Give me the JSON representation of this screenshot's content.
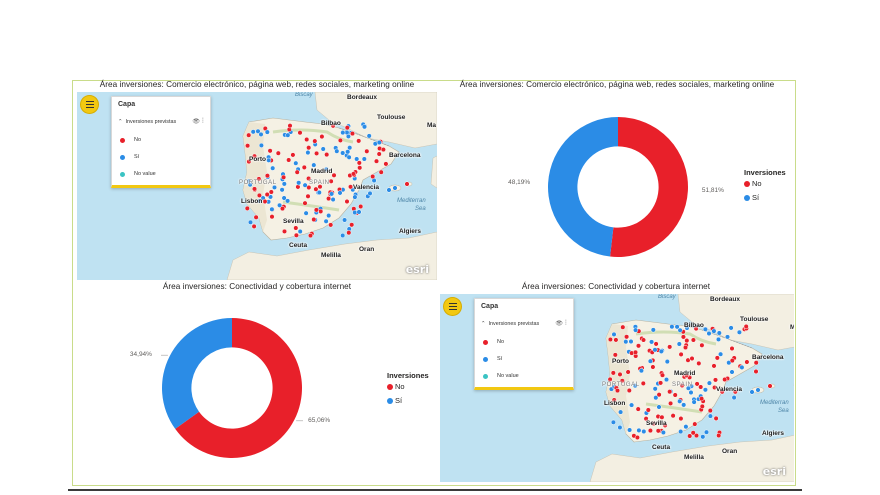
{
  "colors": {
    "no": "#e8202a",
    "si": "#2b8ce6",
    "no_value": "#3ac3c3",
    "accent": "#f2c811"
  },
  "visuals": {
    "map1": {
      "title": "Área inversiones: Comercio electrónico, página web, redes sociales, marketing online"
    },
    "donut1": {
      "title": "Área inversiones: Comercio electrónico, página web, redes sociales, marketing online"
    },
    "donut2": {
      "title": "Área inversiones: Conectividad y cobertura internet"
    },
    "map2": {
      "title": "Área inversiones: Conectividad y cobertura internet"
    }
  },
  "map_legend": {
    "title": "Capa",
    "layer_label": "Inversiones previstas",
    "eye_icon": "eye-icon",
    "more_icon": "more-options-icon",
    "items": [
      {
        "label": "No",
        "color": "#e8202a"
      },
      {
        "label": "Sí",
        "color": "#2b8ce6"
      },
      {
        "label": "No value",
        "color": "#3ac3c3"
      }
    ]
  },
  "map_labels": {
    "biscay": "Biscay",
    "bordeaux": "Bordeaux",
    "toulouse": "Toulouse",
    "ma": "Ma",
    "bilbao": "Bilbao",
    "porto": "Porto",
    "barcelona": "Barcelona",
    "madrid": "Madrid",
    "portugal": "PORTUGAL",
    "spain": "SPAIN",
    "valencia": "Valencia",
    "lisbon": "Lisbon",
    "mediterranean": "Mediterran",
    "sea": "Sea",
    "sevilla": "Sevilla",
    "ceuta": "Ceuta",
    "oran": "Oran",
    "melilla": "Melilla",
    "algiers": "Algiers",
    "esri": "esri"
  },
  "donut_legend": {
    "title": "Inversiones",
    "no": "No",
    "si": "Sí"
  },
  "chart_data": [
    {
      "type": "pie",
      "title": "Área inversiones: Comercio electrónico, página web, redes sociales, marketing online",
      "categories": [
        "No",
        "Sí"
      ],
      "values": [
        51.81,
        48.19
      ],
      "labels": [
        "51,81%",
        "48,19%"
      ],
      "legend_title": "Inversiones",
      "donut": true
    },
    {
      "type": "pie",
      "title": "Área inversiones: Conectividad y cobertura internet",
      "categories": [
        "No",
        "Sí"
      ],
      "values": [
        65.06,
        34.94
      ],
      "labels": [
        "65,06%",
        "34,94%"
      ],
      "legend_title": "Inversiones",
      "donut": true
    }
  ]
}
